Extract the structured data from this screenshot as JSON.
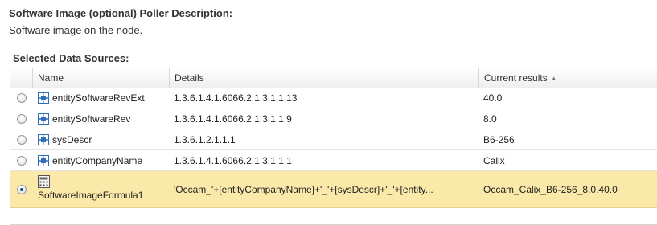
{
  "poller": {
    "heading": "Software Image (optional) Poller Description:",
    "description": "Software image on the node."
  },
  "data_sources": {
    "label": "Selected Data Sources:",
    "columns": {
      "name": "Name",
      "details": "Details",
      "results": "Current results",
      "sort_indicator": "▲"
    },
    "rows": [
      {
        "name": "entitySoftwareRevExt",
        "details": "1.3.6.1.4.1.6066.2.1.3.1.1.13",
        "result": "40.0",
        "icon": "oid-poller-icon",
        "selected": false
      },
      {
        "name": "entitySoftwareRev",
        "details": "1.3.6.1.4.1.6066.2.1.3.1.1.9",
        "result": "8.0",
        "icon": "oid-poller-icon",
        "selected": false
      },
      {
        "name": "sysDescr",
        "details": "1.3.6.1.2.1.1.1",
        "result": "B6-256",
        "icon": "oid-poller-icon",
        "selected": false
      },
      {
        "name": "entityCompanyName",
        "details": "1.3.6.1.4.1.6066.2.1.3.1.1.1",
        "result": "Calix",
        "icon": "oid-poller-icon",
        "selected": false
      },
      {
        "name": "SoftwareImageFormula1",
        "details": "'Occam_'+[entityCompanyName]+'_'+[sysDescr]+'_'+[entity...",
        "result": "Occam_Calix_B6-256_8.0.40.0",
        "icon": "calculator-icon",
        "selected": true
      }
    ]
  },
  "colors": {
    "selected_row": "#fbe9a9",
    "header_border": "#d6d6d6",
    "icon_blue": "#2f6fb8"
  }
}
